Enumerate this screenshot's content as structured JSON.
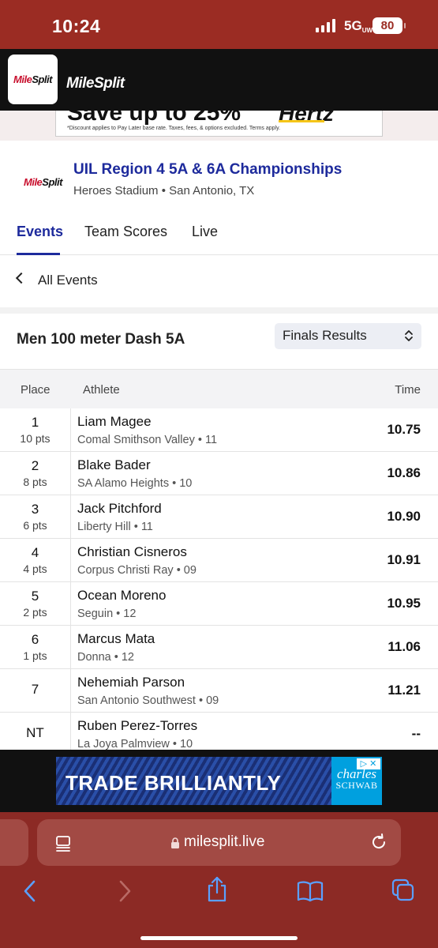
{
  "status": {
    "time": "10:24",
    "network": "5G",
    "network_sub": "UW",
    "battery": "80"
  },
  "app": {
    "logo_mile": "Mile",
    "logo_split": "Split",
    "brand": "MileSplit"
  },
  "top_ad": {
    "headline": "Save up to 25%",
    "brand": "Hertz",
    "fine_print": "*Discount applies to Pay Later base rate. Taxes, fees, & options excluded. Terms apply."
  },
  "meet": {
    "title": "UIL Region 4 5A & 6A Championships",
    "venue": "Heroes Stadium • San Antonio, TX",
    "tabs": [
      {
        "label": "Events"
      },
      {
        "label": "Team Scores"
      },
      {
        "label": "Live"
      }
    ]
  },
  "nav": {
    "back_label": "All Events"
  },
  "event": {
    "name": "Men 100 meter Dash 5A",
    "results_select": "Finals Results"
  },
  "table": {
    "headers": {
      "place": "Place",
      "athlete": "Athlete",
      "time": "Time"
    },
    "rows": [
      {
        "place": "1",
        "points": "10 pts",
        "athlete": "Liam Magee",
        "school": "Comal Smithson Valley • 11",
        "mark": "10.75"
      },
      {
        "place": "2",
        "points": "8 pts",
        "athlete": "Blake Bader",
        "school": "SA Alamo Heights • 10",
        "mark": "10.86"
      },
      {
        "place": "3",
        "points": "6 pts",
        "athlete": "Jack Pitchford",
        "school": "Liberty Hill • 11",
        "mark": "10.90"
      },
      {
        "place": "4",
        "points": "4 pts",
        "athlete": "Christian Cisneros",
        "school": "Corpus Christi Ray • 09",
        "mark": "10.91"
      },
      {
        "place": "5",
        "points": "2 pts",
        "athlete": "Ocean Moreno",
        "school": "Seguin • 12",
        "mark": "10.95"
      },
      {
        "place": "6",
        "points": "1 pts",
        "athlete": "Marcus Mata",
        "school": "Donna • 12",
        "mark": "11.06"
      },
      {
        "place": "7",
        "points": "",
        "athlete": "Nehemiah Parson",
        "school": "San Antonio Southwest • 09",
        "mark": "11.21"
      },
      {
        "place": "NT",
        "points": "",
        "athlete": "Ruben Perez-Torres",
        "school": "La Joya Palmview • 10",
        "mark": "--"
      }
    ]
  },
  "bottom_ad": {
    "headline": "TRADE BRILLIANTLY",
    "brand_top": "charles",
    "brand_bottom": "SCHWAB",
    "badge": "▷ ✕"
  },
  "browser": {
    "url": "milesplit.live"
  },
  "colors": {
    "brand_blue": "#1d2a9c",
    "status_red": "#9b2c23",
    "safari_red": "#8c2a25"
  }
}
